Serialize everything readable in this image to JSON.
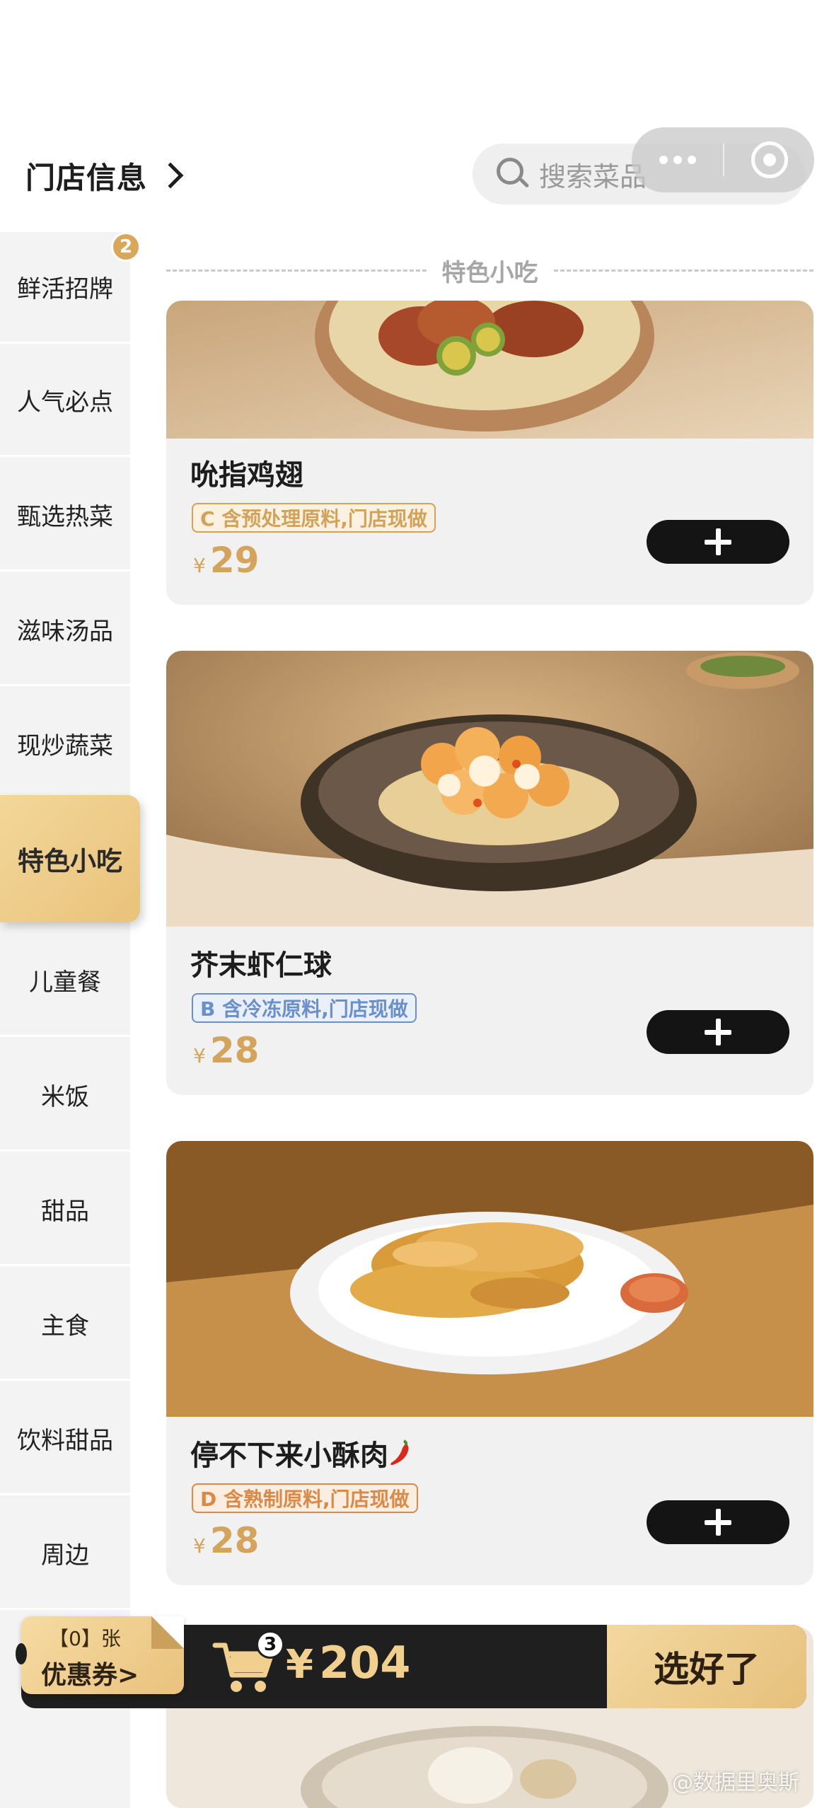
{
  "header": {
    "store_info_label": "门店信息",
    "search_placeholder": "搜索菜品"
  },
  "sidebar": {
    "badge_count": "2",
    "items": [
      {
        "label": "鲜活招牌"
      },
      {
        "label": "人气必点"
      },
      {
        "label": "甄选热菜"
      },
      {
        "label": "滋味汤品"
      },
      {
        "label": "现炒蔬菜"
      },
      {
        "label": "特色小吃",
        "active": true
      },
      {
        "label": "儿童餐"
      },
      {
        "label": "米饭"
      },
      {
        "label": "甜品"
      },
      {
        "label": "主食"
      },
      {
        "label": "饮料甜品"
      },
      {
        "label": "周边"
      }
    ]
  },
  "section": {
    "title": "特色小吃"
  },
  "dishes": [
    {
      "name": "吮指鸡翅",
      "tag": "C 含预处理原料,门店现做",
      "tag_color": "#d2a15a",
      "currency": "¥",
      "price": "29"
    },
    {
      "name": "芥末虾仁球",
      "tag": "B 含冷冻原料,门店现做",
      "tag_color": "#6a8fc9",
      "currency": "¥",
      "price": "28"
    },
    {
      "name": "停不下来小酥肉",
      "spicy_icon": "chili-pepper-icon",
      "tag": "D 含熟制原料,门店现做",
      "tag_color": "#d98a48",
      "currency": "¥",
      "price": "28"
    }
  ],
  "cart": {
    "coupon_line1": "【0】张",
    "coupon_line2": "优惠券>",
    "item_count": "3",
    "currency": "¥",
    "total": "204",
    "checkout_label": "选好了"
  },
  "watermark": "@数据里奥斯",
  "colors": {
    "accent_gold": "#e9c27a",
    "price_gold": "#d5a45c",
    "dark": "#141414"
  }
}
